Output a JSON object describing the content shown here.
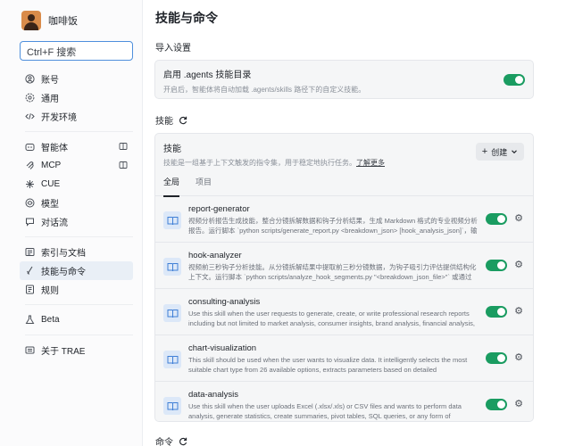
{
  "profile": {
    "name": "咖啡饭"
  },
  "search": {
    "label": "Ctrl+F 搜索"
  },
  "sidebar": {
    "groups": [
      [
        {
          "label": "账号",
          "icon": "user-icon"
        },
        {
          "label": "通用",
          "icon": "gear-icon"
        },
        {
          "label": "开发环境",
          "icon": "code-icon"
        }
      ],
      [
        {
          "label": "智能体",
          "icon": "agent-icon",
          "external": true
        },
        {
          "label": "MCP",
          "icon": "mcp-icon",
          "external": true
        },
        {
          "label": "CUE",
          "icon": "sparkle-icon"
        },
        {
          "label": "模型",
          "icon": "model-icon"
        },
        {
          "label": "对话流",
          "icon": "chat-flow-icon"
        }
      ],
      [
        {
          "label": "索引与文档",
          "icon": "index-icon"
        },
        {
          "label": "技能与命令",
          "icon": "skills-icon",
          "active": true
        },
        {
          "label": "规则",
          "icon": "rules-icon"
        }
      ],
      [
        {
          "label": "Beta",
          "icon": "beta-icon"
        }
      ],
      [
        {
          "label": "关于 TRAE",
          "icon": "about-icon"
        }
      ]
    ]
  },
  "main": {
    "title": "技能与命令",
    "import": {
      "section": "导入设置",
      "title": "启用 .agents 技能目录",
      "desc": "开启后，智能体将自动加载 .agents/skills 路径下的自定义技能。",
      "enabled": true
    },
    "skills": {
      "section": "技能",
      "card_title": "技能",
      "card_desc": "技能是一组基于上下文触发的指令集，用于稳定地执行任务。",
      "learn_more": "了解更多",
      "create_label": "创建",
      "tabs": [
        "全局",
        "项目"
      ],
      "items": [
        {
          "name": "report-generator",
          "desc": "视频分析报告生成技能，整合分镜拆解数据和钩子分析结果，生成 Markdown 格式的专业视频分析报告。运行脚本 `python scripts/generate_report.py <breakdown_json> [hook_analysis_json]`，输出完...",
          "enabled": true
        },
        {
          "name": "hook-analyzer",
          "desc": "视频前三秒钩子分析技能。从分镜拆解结果中提取前三秒分镜数据，为钩子吸引力评估提供结构化上下文。运行脚本 `python scripts/analyze_hook_segments.py \"<breakdown_json_file>\"` 或通过 stdin...",
          "enabled": true
        },
        {
          "name": "consulting-analysis",
          "desc": "Use this skill when the user requests to generate, create, or write professional research reports including but not limited to market analysis, consumer insights, brand analysis, financial analysis, industry...",
          "enabled": true
        },
        {
          "name": "chart-visualization",
          "desc": "This skill should be used when the user wants to visualize data. It intelligently selects the most suitable chart type from 26 available options, extracts parameters based on detailed specifications, and ge...",
          "enabled": true
        },
        {
          "name": "data-analysis",
          "desc": "Use this skill when the user uploads Excel (.xlsx/.xls) or CSV files and wants to perform data analysis, generate statistics, create summaries, pivot tables, SQL queries, or any form of structured data expl...",
          "enabled": true
        }
      ]
    },
    "commands": {
      "section": "命令"
    }
  },
  "colors": {
    "accent_green": "#1a9c61",
    "search_border": "#4e8fdc",
    "skill_icon_bg": "#dce8f8"
  }
}
